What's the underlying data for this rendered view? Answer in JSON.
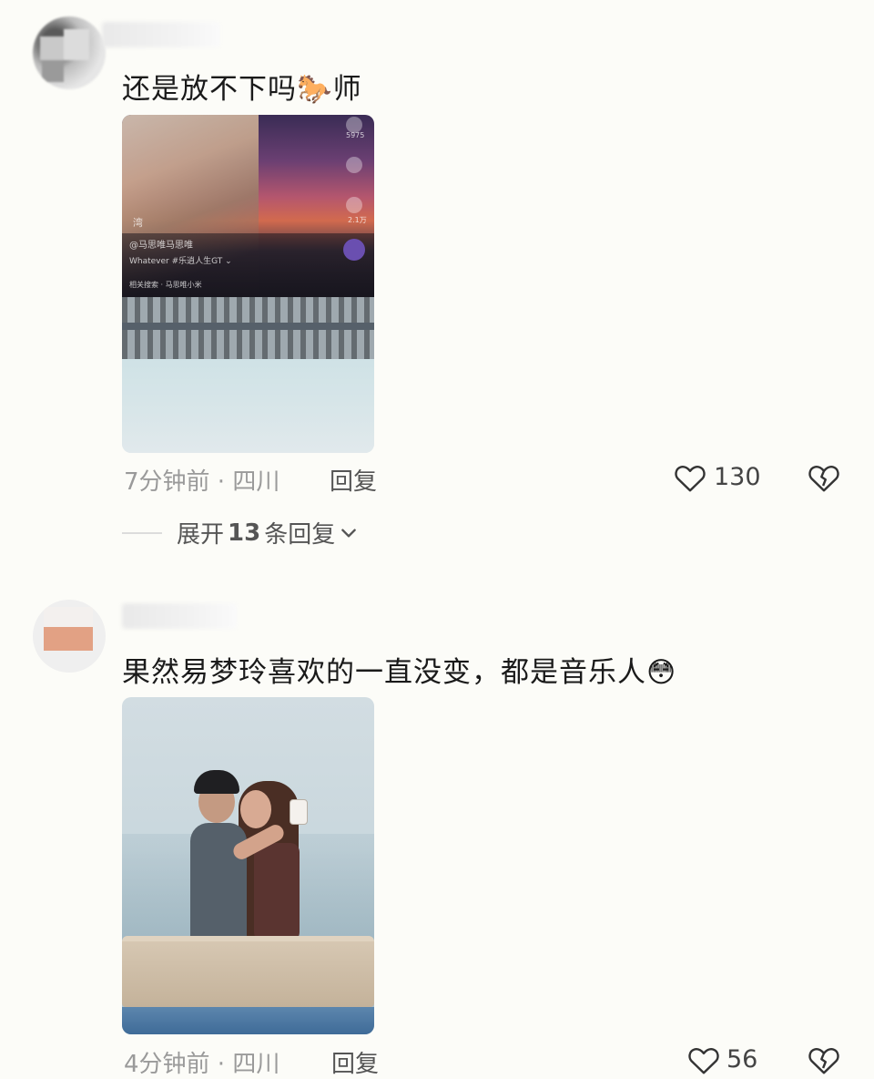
{
  "comments": [
    {
      "text": "还是放不下吗🐎师",
      "media": {
        "overlay_side_count": "5975",
        "overlay_share_count": "2.1万",
        "overlay_tag": "湾",
        "overlay_author": "@马思唯马思唯",
        "overlay_caption": "Whatever  #乐逍人生GT ⌄",
        "overlay_search": "相关搜索 · 马思唯小米"
      },
      "time_location": "7分钟前 · 四川",
      "reply_label": "回复",
      "likes": "130",
      "expand_label": "展开",
      "expand_count": "13",
      "expand_suffix": "条回复"
    },
    {
      "text": "果然易梦玲喜欢的一直没变，都是音乐人😳",
      "time_location": "4分钟前 · 四川",
      "reply_label": "回复",
      "likes": "56"
    }
  ],
  "icons": {
    "like": "heart-outline-icon",
    "dislike": "broken-heart-icon",
    "expand": "chevron-down-icon"
  }
}
